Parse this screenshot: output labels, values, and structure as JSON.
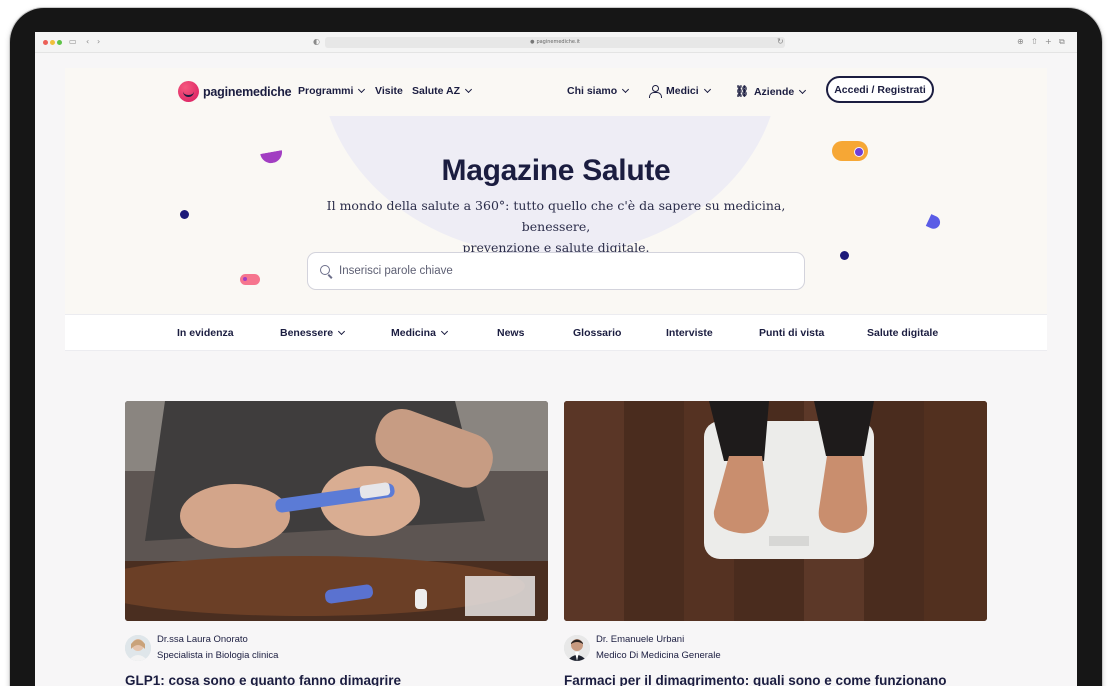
{
  "browser": {
    "url": "paginemediche.it"
  },
  "header": {
    "logo_text": "paginemediche",
    "nav_left": [
      {
        "label": "Programmi"
      },
      {
        "label": "Visite"
      },
      {
        "label": "Salute AZ"
      }
    ],
    "nav_right": [
      {
        "label": "Chi siamo"
      },
      {
        "label": "Medici"
      },
      {
        "label": "Aziende"
      }
    ],
    "login_label": "Accedi / Registrati"
  },
  "hero": {
    "title": "Magazine Salute",
    "subtitle_line1": "Il mondo della salute a 360°: tutto quello che c'è da sapere su medicina, benessere,",
    "subtitle_line2": "prevenzione e salute digitale.",
    "search_placeholder": "Inserisci parole chiave"
  },
  "categories": [
    {
      "label": "In evidenza"
    },
    {
      "label": "Benessere"
    },
    {
      "label": "Medicina"
    },
    {
      "label": "News"
    },
    {
      "label": "Glossario"
    },
    {
      "label": "Interviste"
    },
    {
      "label": "Punti di vista"
    },
    {
      "label": "Salute digitale"
    }
  ],
  "articles": [
    {
      "author_name": "Dr.ssa Laura Onorato",
      "author_role": "Specialista in Biologia clinica",
      "title": "GLP1: cosa sono e quanto fanno dimagrire"
    },
    {
      "author_name": "Dr. Emanuele Urbani",
      "author_role": "Medico Di Medicina Generale",
      "title": "Farmaci per il dimagrimento: quali sono e come funzionano"
    }
  ]
}
